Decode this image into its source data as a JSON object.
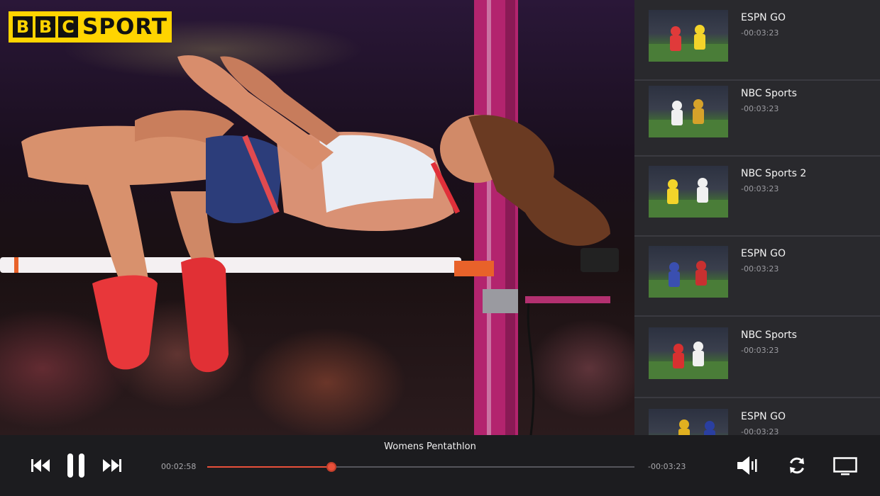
{
  "brand": {
    "letters": [
      "B",
      "B",
      "C"
    ],
    "word": "SPORT"
  },
  "player": {
    "title": "Womens Pentathlon",
    "elapsed": "00:02:58",
    "remaining": "-00:03:23",
    "progress": 0.29
  },
  "channels": [
    {
      "name": "ESPN GO",
      "time": "-00:03:23",
      "kit": [
        "#e03a3a",
        "#f3d42a"
      ]
    },
    {
      "name": "NBC Sports",
      "time": "-00:03:23",
      "kit": [
        "#f0f0f0",
        "#d6a22a"
      ]
    },
    {
      "name": "NBC Sports 2",
      "time": "-00:03:23",
      "kit": [
        "#f3d42a",
        "#f0f0f0"
      ]
    },
    {
      "name": "ESPN GO",
      "time": "-00:03:23",
      "kit": [
        "#3a4fb0",
        "#c83030"
      ]
    },
    {
      "name": "NBC Sports",
      "time": "-00:03:23",
      "kit": [
        "#d83030",
        "#f0f0f0"
      ]
    },
    {
      "name": "ESPN GO",
      "time": "-00:03:23",
      "kit": [
        "#e0b020",
        "#2a3fa0"
      ]
    }
  ],
  "icons": {
    "previous": "skip-previous-icon",
    "pause": "pause-icon",
    "next": "skip-next-icon",
    "volume": "volume-icon",
    "replay": "replay-icon",
    "cast": "cast-screen-icon"
  },
  "colors": {
    "accent": "#e8503a",
    "brand_yellow": "#ffd400",
    "panel": "#29292d",
    "bar": "#1c1c1f"
  }
}
